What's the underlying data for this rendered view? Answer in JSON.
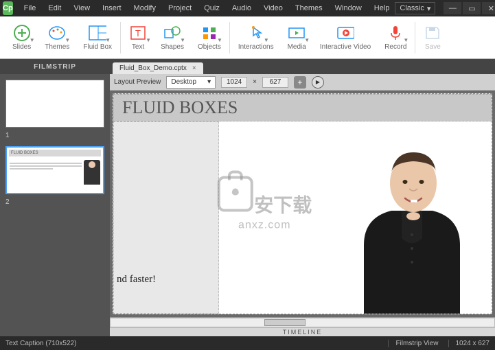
{
  "app": {
    "icon_text": "Cp"
  },
  "menu": [
    "File",
    "Edit",
    "View",
    "Insert",
    "Modify",
    "Project",
    "Quiz",
    "Audio",
    "Video",
    "Themes",
    "Window",
    "Help"
  ],
  "workspace": {
    "selected": "Classic"
  },
  "window_controls": {
    "minimize": "—",
    "maximize": "▭",
    "close": "✕"
  },
  "ribbon": {
    "slides": "Slides",
    "themes": "Themes",
    "fluid_box": "Fluid Box",
    "text": "Text",
    "shapes": "Shapes",
    "objects": "Objects",
    "interactions": "Interactions",
    "media": "Media",
    "interactive_video": "Interactive Video",
    "record": "Record",
    "save": "Save"
  },
  "filmstrip": {
    "title": "FILMSTRIP",
    "slides": [
      {
        "num": "1",
        "title": "",
        "selected": false
      },
      {
        "num": "2",
        "title": "FLUID BOXES",
        "selected": true
      }
    ]
  },
  "tabs": {
    "doc_name": "Fluid_Box_Demo.cptx",
    "close": "×"
  },
  "layout": {
    "label": "Layout Preview",
    "device": "Desktop",
    "width": "1024",
    "sep": "×",
    "height": "627",
    "plus": "+",
    "play": "▶"
  },
  "canvas": {
    "title": "FLUID BOXES",
    "left_text": "nd faster!"
  },
  "watermark": {
    "chinese": "安下载",
    "url": "anxz.com"
  },
  "timeline": {
    "label": "TIMELINE"
  },
  "status": {
    "left": "Text Caption (710x522)",
    "view": "Filmstrip View",
    "dims": "1024 x 627"
  }
}
